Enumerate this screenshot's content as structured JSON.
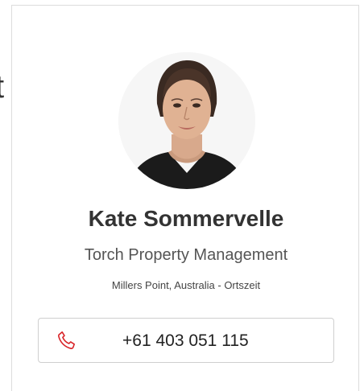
{
  "background": {
    "partial_text": "t"
  },
  "agent": {
    "name": "Kate Sommervelle",
    "company": "Torch Property Management",
    "location": "Millers Point, Australia - Ortszeit",
    "phone": "+61 403 051 115"
  },
  "icons": {
    "phone": "phone-icon"
  },
  "colors": {
    "phone_icon": "#d9262a",
    "card_border": "#dcdcdc",
    "name_text": "#333333"
  }
}
